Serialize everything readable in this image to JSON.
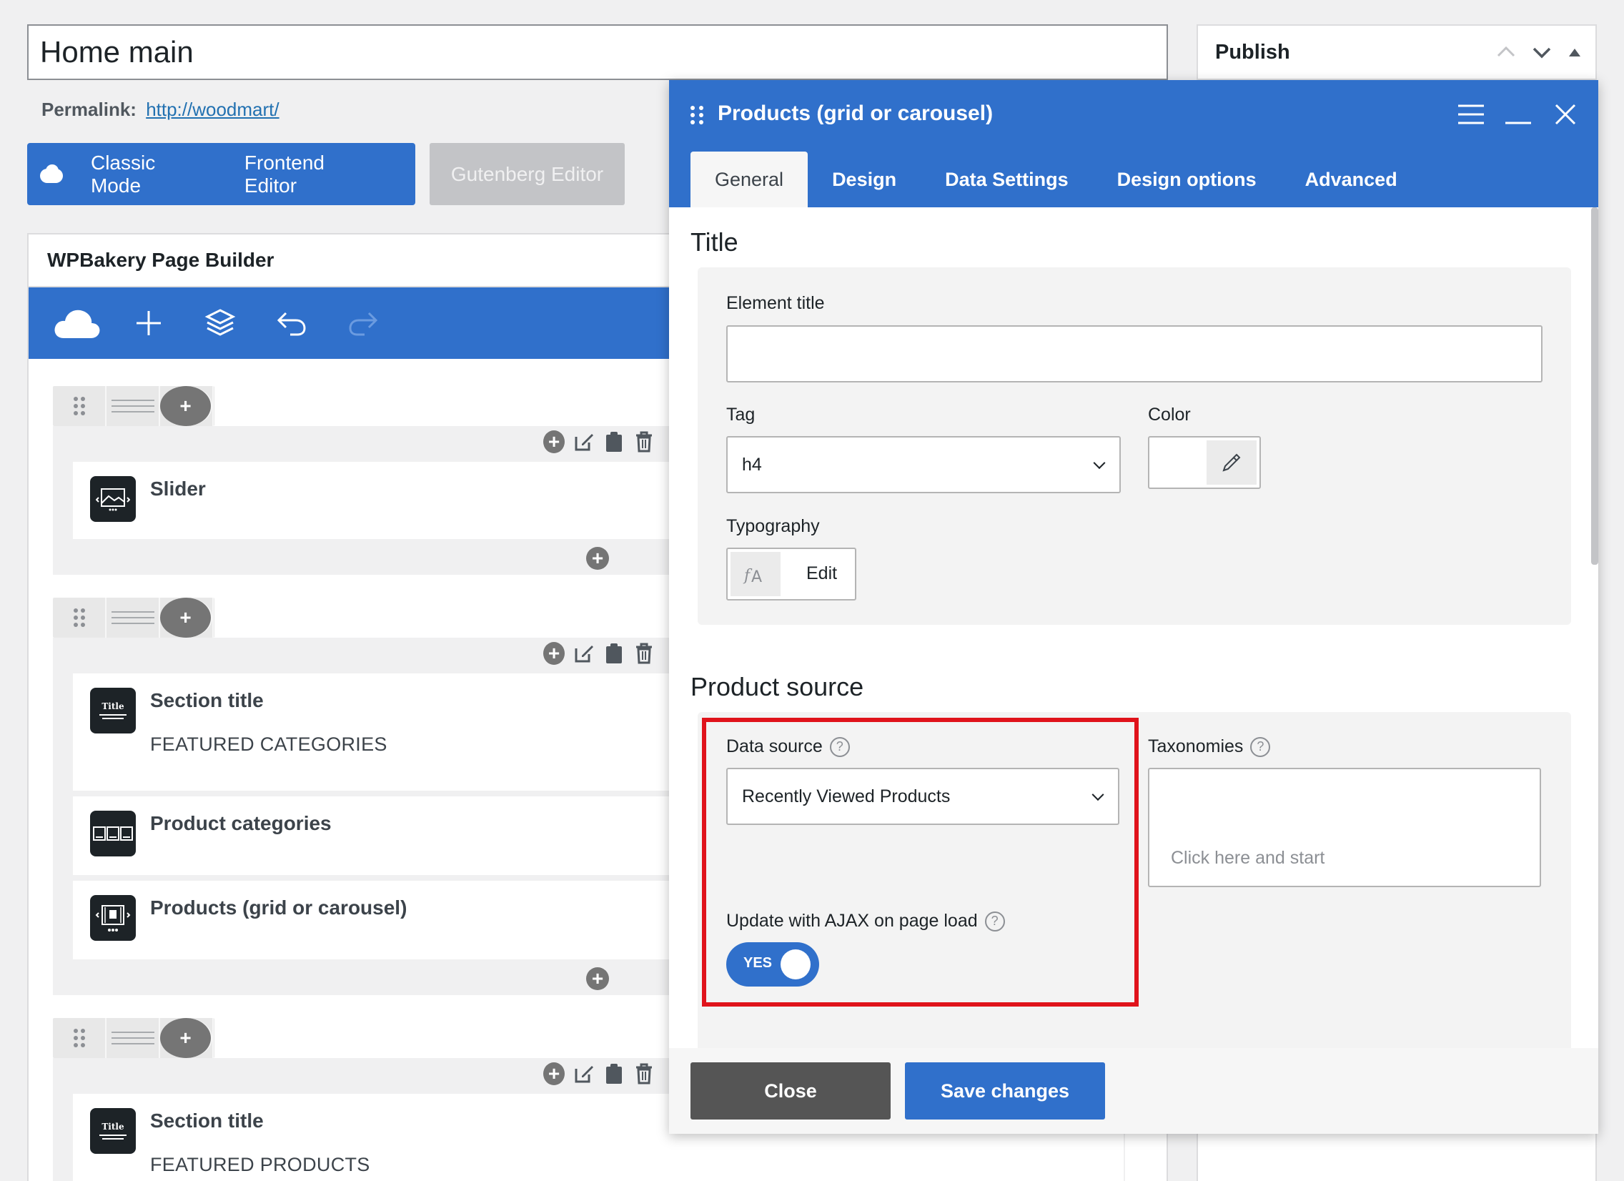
{
  "post_title": "Home main",
  "permalink": {
    "label": "Permalink:",
    "url": "http://woodmart/"
  },
  "modes": {
    "classic": "Classic Mode",
    "frontend": "Frontend Editor",
    "gutenberg": "Gutenberg Editor"
  },
  "publish": {
    "title": "Publish"
  },
  "builder": {
    "title": "WPBakery Page Builder",
    "toolbar_icons": [
      "cloud-logo-icon",
      "add-element-icon",
      "layers-icon",
      "undo-icon",
      "redo-icon"
    ],
    "rows": [
      {
        "elements": [
          {
            "name": "Slider",
            "sub": ""
          }
        ]
      },
      {
        "elements": [
          {
            "name": "Section title",
            "sub": "FEATURED CATEGORIES"
          },
          {
            "name": "Product categories",
            "sub": ""
          },
          {
            "name": "Products (grid or carousel)",
            "sub": ""
          }
        ]
      },
      {
        "elements": [
          {
            "name": "Section title",
            "sub": "FEATURED PRODUCTS"
          }
        ]
      }
    ],
    "title_badge": "Title"
  },
  "modal": {
    "title": "Products (grid or carousel)",
    "tabs": [
      "General",
      "Design",
      "Data Settings",
      "Design options",
      "Advanced"
    ],
    "active_tab": "General",
    "title_section": {
      "heading": "Title",
      "element_title_label": "Element title",
      "element_title_value": "",
      "tag_label": "Tag",
      "tag_value": "h4",
      "color_label": "Color",
      "typography_label": "Typography",
      "typography_button": "Edit"
    },
    "product_source": {
      "heading": "Product source",
      "data_source_label": "Data source",
      "data_source_value": "Recently Viewed Products",
      "taxonomies_label": "Taxonomies",
      "taxonomies_placeholder": "Click here and start",
      "ajax_label": "Update with AJAX on page load",
      "ajax_toggle": "YES"
    },
    "buttons": {
      "close": "Close",
      "save": "Save changes"
    }
  },
  "colors": {
    "accent": "#3070cb",
    "highlight": "#e0131b",
    "close_btn": "#555555"
  }
}
